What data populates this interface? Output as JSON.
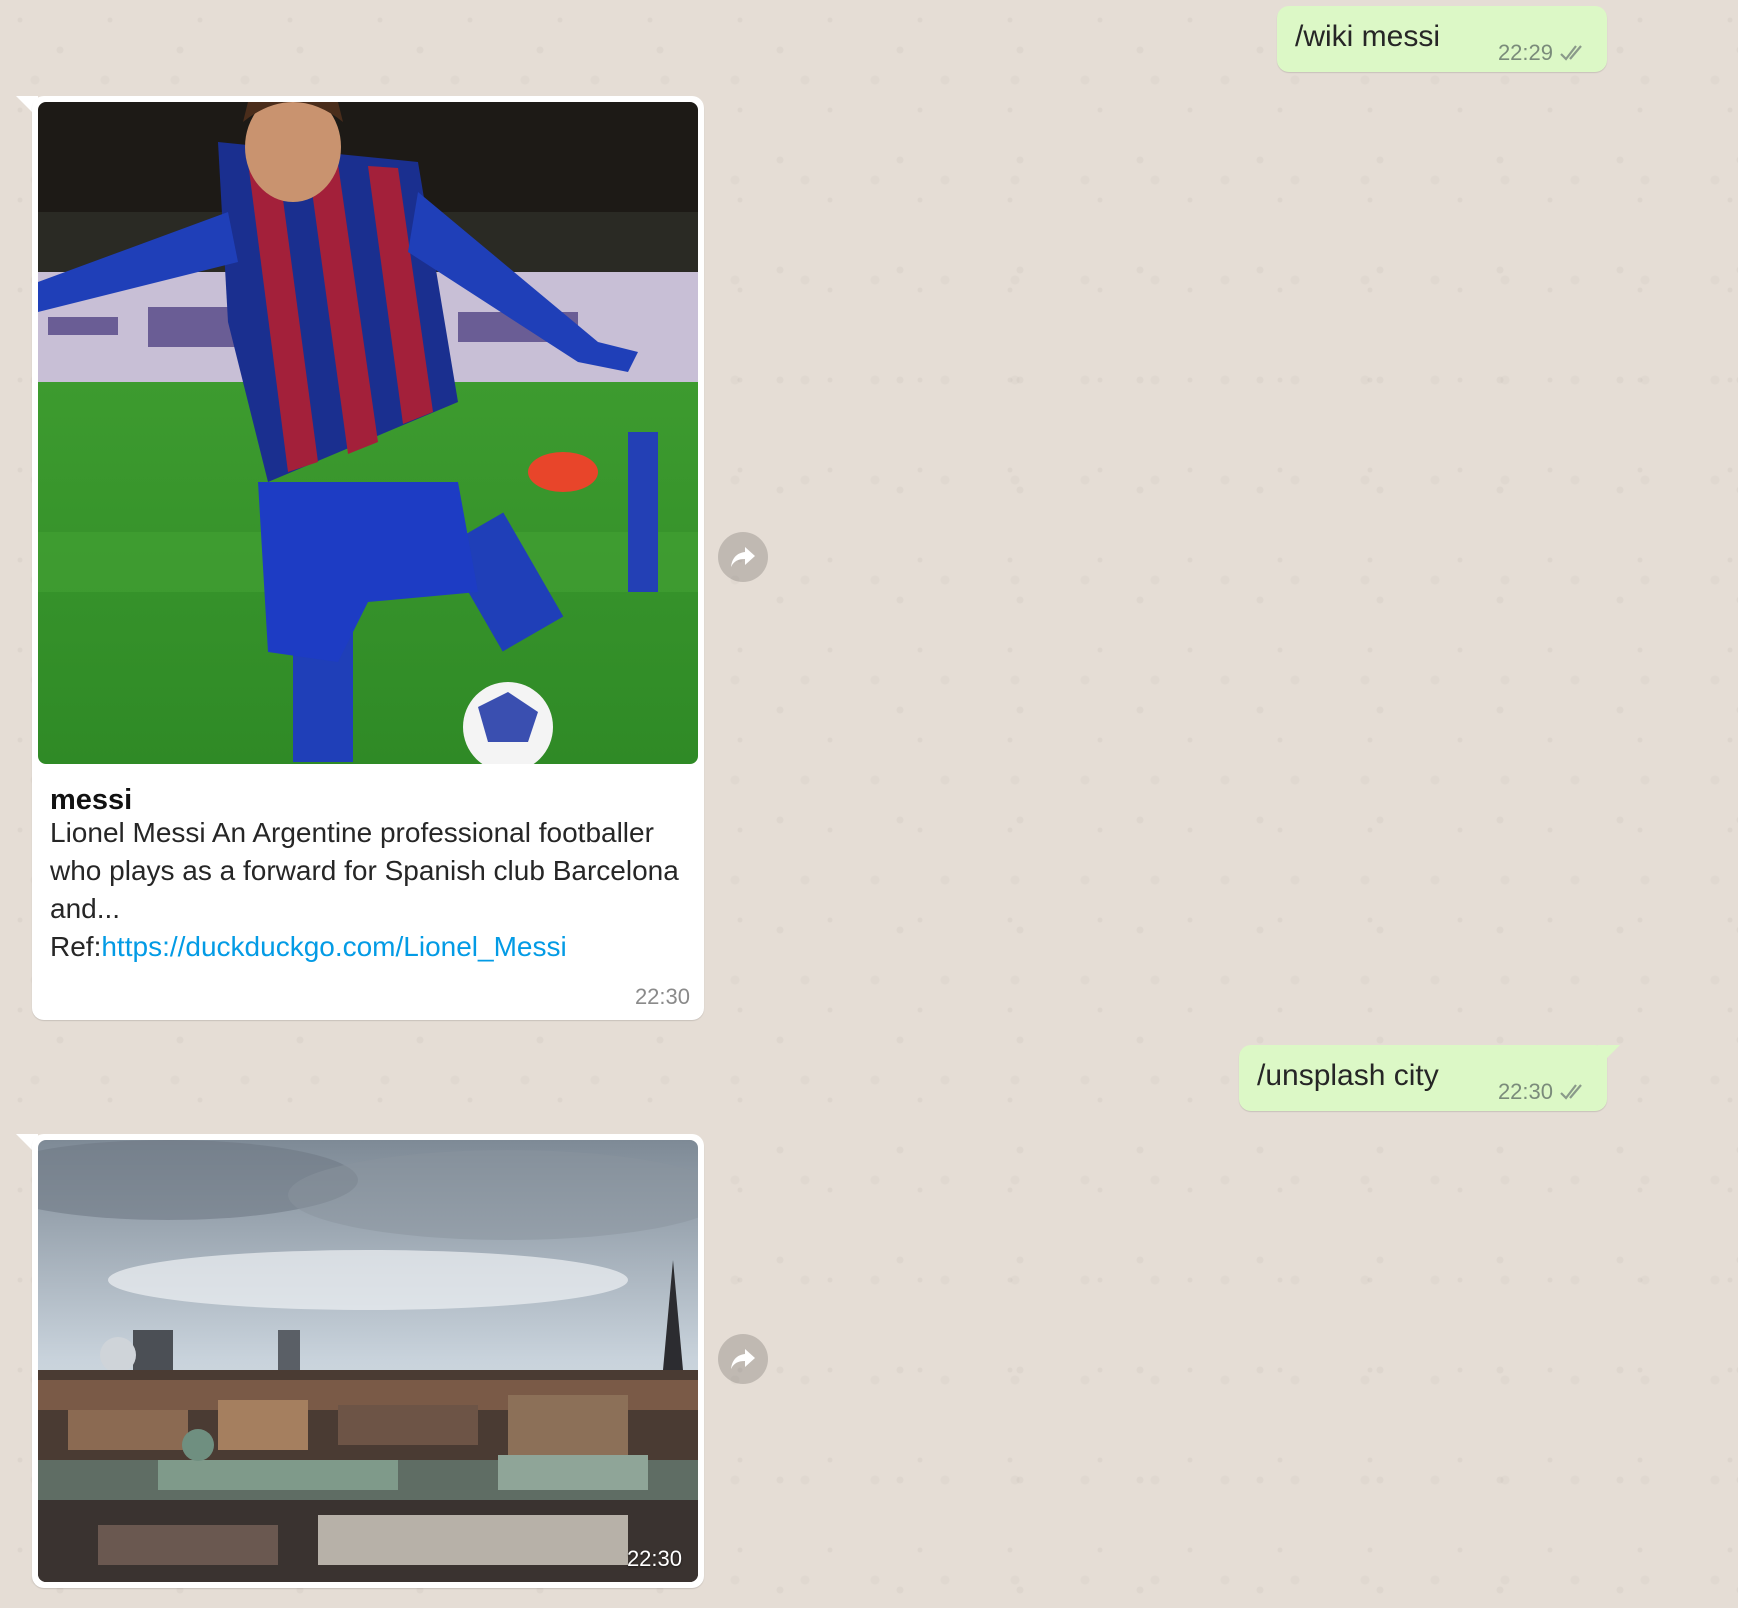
{
  "messages": {
    "out1": {
      "text": "/wiki messi",
      "time": "22:29"
    },
    "in1": {
      "title": "messi",
      "body": "Lionel Messi An Argentine professional footballer who plays as a forward for Spanish club Barcelona and...",
      "ref_label": "Ref:",
      "link": "https://duckduckgo.com/Lionel_Messi",
      "time": "22:30"
    },
    "out2": {
      "text": "/unsplash city",
      "time": "22:30"
    },
    "in2": {
      "time": "22:30"
    }
  },
  "colors": {
    "chat_background": "#e5ddd5",
    "outgoing_bubble": "#dcf8c6",
    "incoming_bubble": "#ffffff",
    "link": "#039be5"
  },
  "icons": {
    "read_receipt": "double-check-icon",
    "forward": "forward-arrow-icon"
  }
}
